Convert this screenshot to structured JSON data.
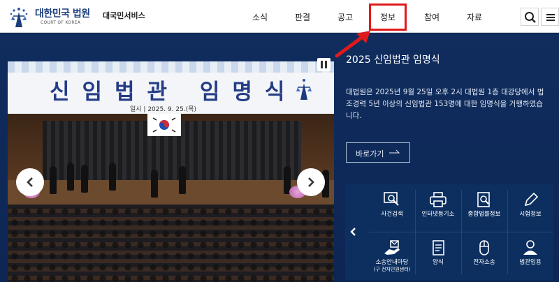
{
  "header": {
    "logo_title": "대한민국 법원",
    "logo_sub": "COURT OF KOREA",
    "site_name": "대국민서비스",
    "nav": [
      "소식",
      "판결",
      "공고",
      "정보",
      "참여",
      "자료"
    ],
    "active_nav": "정보"
  },
  "slide": {
    "banner_title": "신임법관 임명식",
    "banner_date": "일시 | 2025. 9. 25.(목)"
  },
  "news": {
    "title": "2025 신임법관 임명식",
    "body": "대법원은 2025년 9월 25일 오후 2시 대법원 1층 대강당에서 법조경력 5년 이상의 신임법관 153명에 대한 임명식을 거행하였습니다.",
    "go_label": "바로가기"
  },
  "quick_menu": [
    {
      "label": "사건검색",
      "icon": "magnifier-screen-icon"
    },
    {
      "label": "인터넷등기소",
      "icon": "printer-icon"
    },
    {
      "label": "종합법률정보",
      "icon": "document-search-icon"
    },
    {
      "label": "시험정보",
      "icon": "pen-icon"
    },
    {
      "label": "소송안내마당",
      "sublabel": "(구 전자민원센터)",
      "icon": "hand-document-icon"
    },
    {
      "label": "양식",
      "icon": "form-icon"
    },
    {
      "label": "전자소송",
      "icon": "mouse-icon"
    },
    {
      "label": "법관임용",
      "icon": "judge-icon"
    }
  ],
  "colors": {
    "accent_red": "#e01a1a",
    "main_bg": "#0e2a5a",
    "brand_blue": "#1a3d7c"
  }
}
